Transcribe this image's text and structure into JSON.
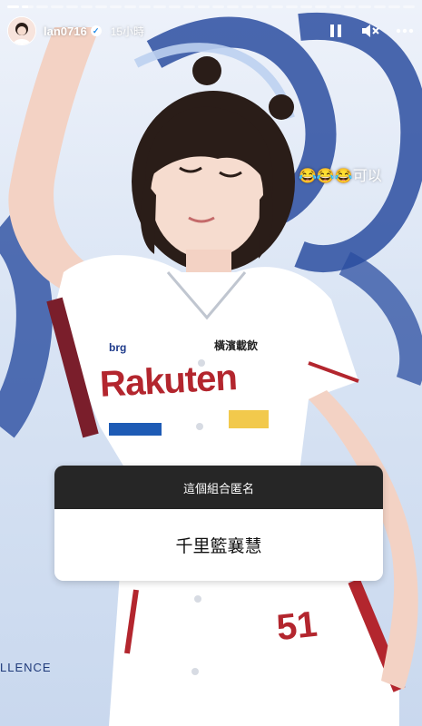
{
  "story": {
    "progress": [
      1,
      0.55,
      0,
      0,
      0,
      0,
      0,
      0,
      0,
      0,
      0,
      0,
      0,
      0,
      0,
      0,
      0,
      0,
      0,
      0,
      0,
      0,
      0,
      0,
      0,
      0,
      0,
      0
    ]
  },
  "header": {
    "username": "lan0716",
    "time": "15小時",
    "icons": [
      "pause-icon",
      "mute-icon",
      "more-icon"
    ]
  },
  "overlay": {
    "caption": "😂😂😂可以"
  },
  "jersey": {
    "sponsor_left": "brg",
    "brand": "Rakuten",
    "team": "橫濱載飲",
    "number": "51"
  },
  "question": {
    "prompt": "這個組合匿名",
    "answer": "千里籃襄慧"
  },
  "background": {
    "banner_text": "LLENCE"
  },
  "colors": {
    "jersey_red": "#b3262e",
    "question_header": "#262626",
    "banner_blue": "#1f3a7a"
  }
}
